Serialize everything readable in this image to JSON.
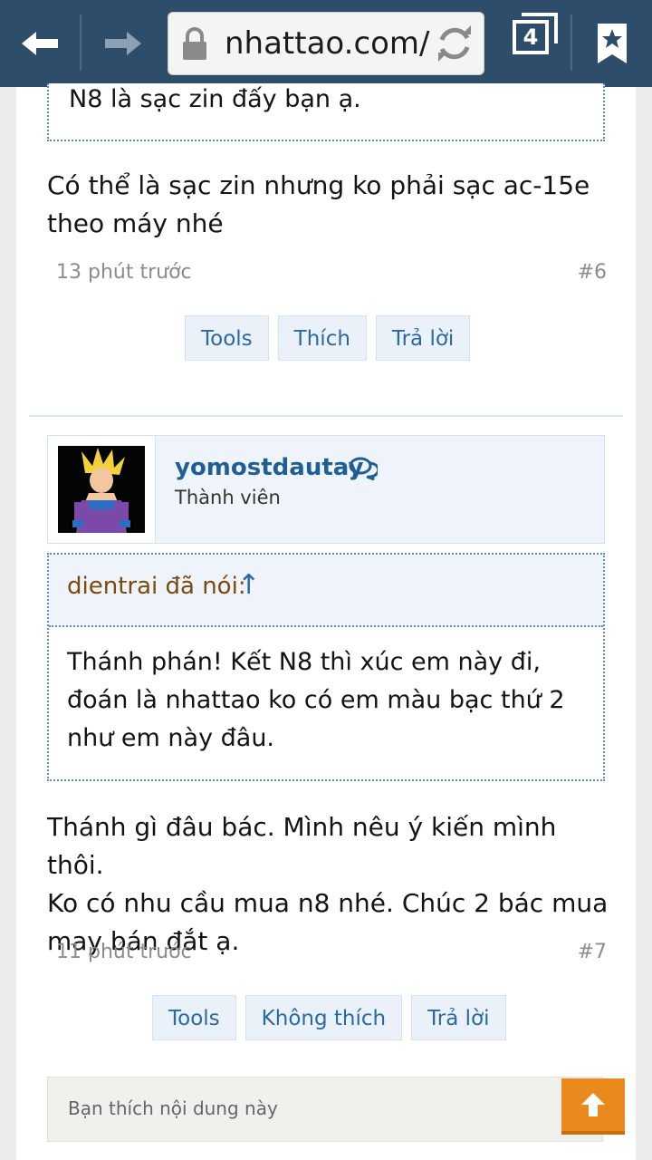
{
  "browser": {
    "url": "nhattao.com/",
    "tab_count": "4"
  },
  "post6": {
    "quote_tail": "N8 là sạc zin đấy bạn ạ.",
    "text_line1": "Có thể là sạc zin nhưng ko phải sạc ac-15e",
    "text_line2": "theo máy nhé",
    "time": "13 phút trước",
    "number": "#6",
    "actions": [
      "Tools",
      "Thích",
      "Trả lời"
    ]
  },
  "post7": {
    "username": "yomostdautay",
    "role": "Thành viên",
    "quote_author": "dientrai đã nói:",
    "quote_arrow": "↑",
    "quote_line1": "Thánh phán! Kết N8 thì xúc em này đi,",
    "quote_line2": "đoán là nhattao ko có em màu bạc thứ 2",
    "quote_line3": "như em này đâu.",
    "text_line1": "Thánh gì đâu bác. Mình nêu ý kiến mình thôi.",
    "text_line2": "Ko có nhu cầu mua n8 nhé. Chúc 2 bác mua",
    "text_line3": "may bán đắt ạ.",
    "time": "11 phút trước",
    "number": "#7",
    "actions": [
      "Tools",
      "Không thích",
      "Trả lời"
    ]
  },
  "reply": {
    "placeholder": "Bạn thích nội dung này"
  },
  "colors": {
    "toolbar": "#2e4d6b",
    "link": "#2a6aa0",
    "accent": "#eb8a1c"
  }
}
